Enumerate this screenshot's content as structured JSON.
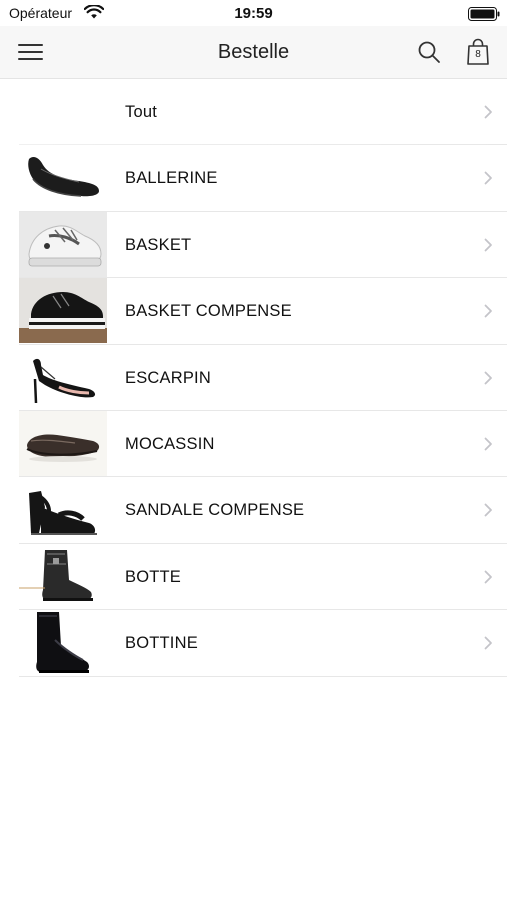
{
  "status_bar": {
    "carrier": "Opérateur",
    "time": "19:59"
  },
  "nav": {
    "title": "Bestelle",
    "cart_count": "8"
  },
  "categories": [
    {
      "label": "Tout"
    },
    {
      "label": "BALLERINE"
    },
    {
      "label": "BASKET"
    },
    {
      "label": "BASKET COMPENSE"
    },
    {
      "label": "ESCARPIN"
    },
    {
      "label": "MOCASSIN"
    },
    {
      "label": "SANDALE COMPENSE"
    },
    {
      "label": "BOTTE"
    },
    {
      "label": "BOTTINE"
    }
  ],
  "colors": {
    "nav_background": "#f7f7f7",
    "separator": "#e7e7e7",
    "chevron": "#c4c4c9",
    "text": "#111111"
  }
}
